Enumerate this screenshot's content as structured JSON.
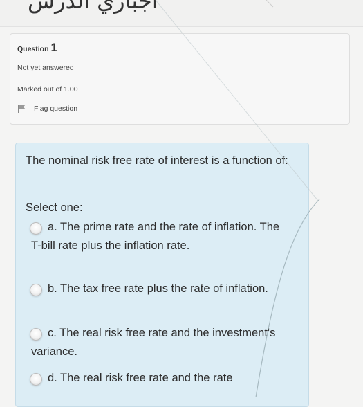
{
  "header": {
    "cut_text": "اجباري الدرس"
  },
  "info": {
    "question_word": "Question",
    "question_number": "1",
    "status": "Not yet answered",
    "marks": "Marked out of 1.00",
    "flag_label": "Flag question"
  },
  "question": {
    "text": "The nominal risk free rate of interest is a function of:",
    "select_label": "Select one:",
    "options": [
      {
        "text": "a. The prime rate and the rate of inflation. The T-bill rate plus the inflation rate."
      },
      {
        "text": "b. The tax free rate plus the rate of inflation."
      },
      {
        "text": "c. The real risk free rate and the investment's variance."
      },
      {
        "text": "d. The real risk free rate and the rate"
      }
    ]
  },
  "colors": {
    "background": "#f4f4f3",
    "info_card": "#f7f7f7",
    "question_card": "#dcedf5",
    "flag": "#8a8a8a"
  }
}
